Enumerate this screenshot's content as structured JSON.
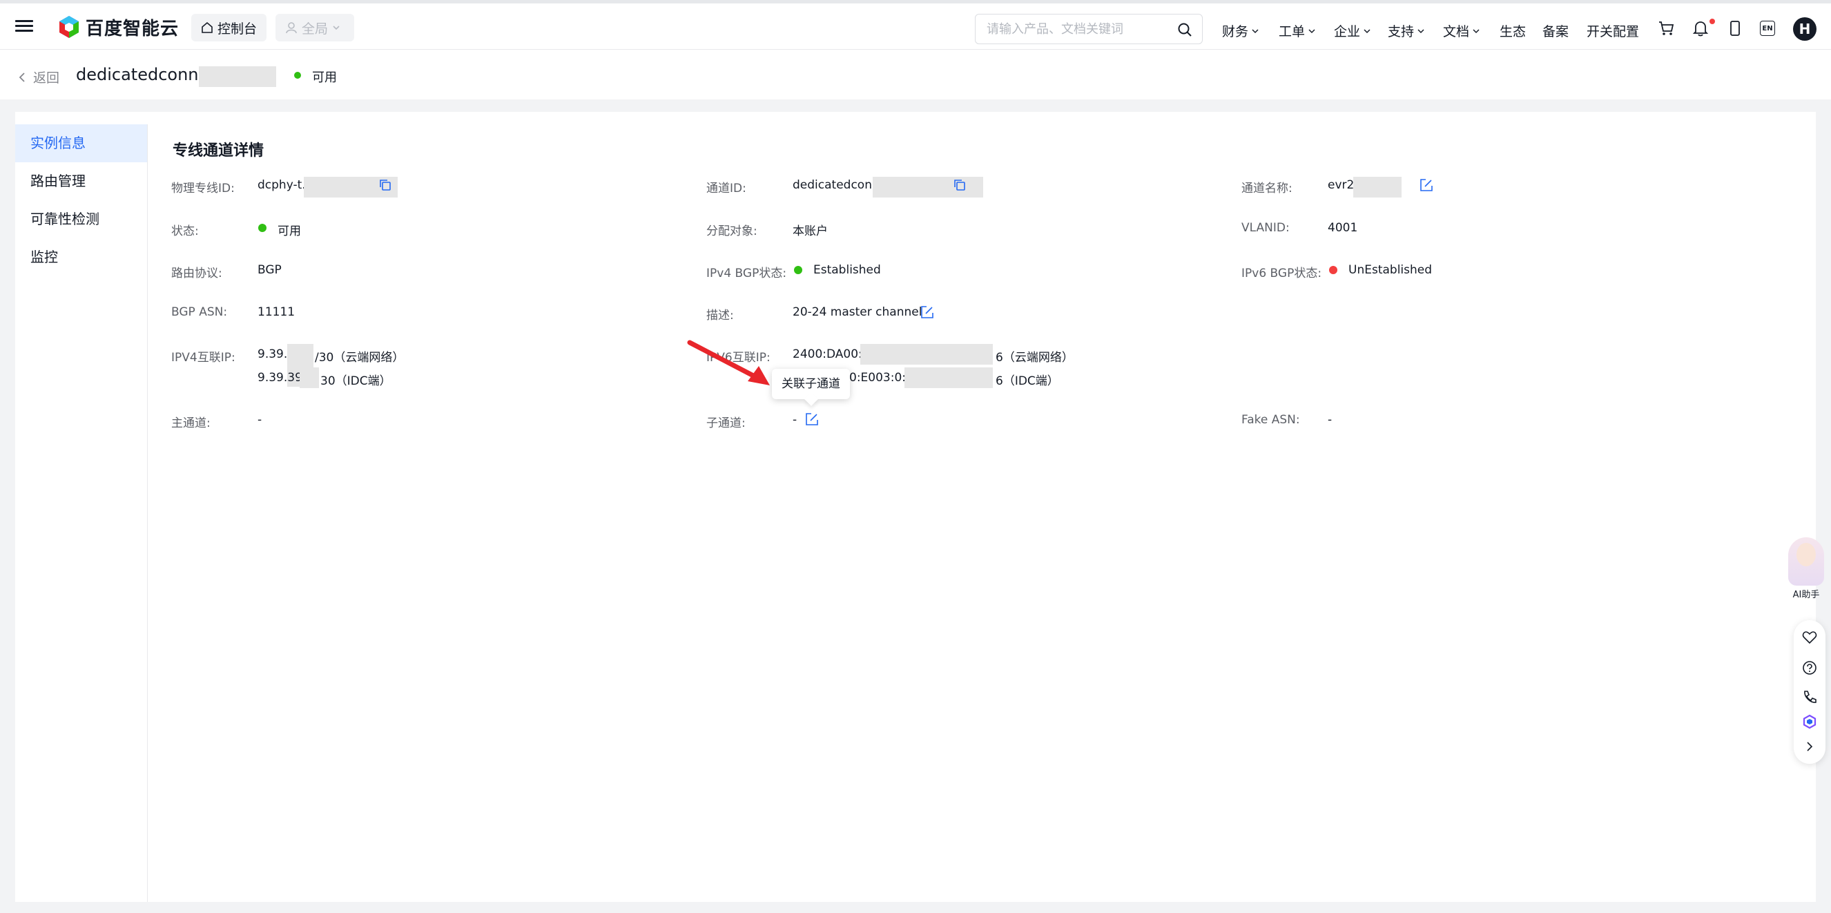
{
  "topbar": {
    "logo_text": "百度智能云",
    "console_label": "控制台",
    "region_label": "全局",
    "search_placeholder": "请输入产品、文档关键词",
    "nav": [
      {
        "label": "财务",
        "dropdown": true
      },
      {
        "label": "工单",
        "dropdown": true
      },
      {
        "label": "企业",
        "dropdown": true
      },
      {
        "label": "支持",
        "dropdown": true
      },
      {
        "label": "文档",
        "dropdown": true
      },
      {
        "label": "生态",
        "dropdown": false
      },
      {
        "label": "备案",
        "dropdown": false
      },
      {
        "label": "开关配置",
        "dropdown": false
      }
    ],
    "icons": [
      "cart-icon",
      "bell-icon",
      "mobile-icon",
      "language-en-icon"
    ],
    "lang_badge": "EN",
    "avatar_letter": "H"
  },
  "header": {
    "back_label": "返回",
    "title": "dedicatedconn",
    "title_suffix": "",
    "status": "可用"
  },
  "sidebar": {
    "items": [
      {
        "label": "实例信息",
        "active": true
      },
      {
        "label": "路由管理",
        "active": false
      },
      {
        "label": "可靠性检测",
        "active": false
      },
      {
        "label": "监控",
        "active": false
      }
    ]
  },
  "details": {
    "title": "专线通道详情",
    "fields": {
      "physical_id": {
        "label": "物理专线ID:",
        "value": "dcphy-t..."
      },
      "channel_id": {
        "label": "通道ID:",
        "value": "dedicatedcon..."
      },
      "channel_name": {
        "label": "通道名称:",
        "value": "evr2..."
      },
      "status": {
        "label": "状态:",
        "value": "可用"
      },
      "assigned_to": {
        "label": "分配对象:",
        "value": "本账户"
      },
      "vlan_id": {
        "label": "VLANID:",
        "value": "4001"
      },
      "route_protocol": {
        "label": "路由协议:",
        "value": "BGP"
      },
      "ipv4_bgp_status": {
        "label": "IPv4 BGP状态:",
        "value": "Established"
      },
      "ipv6_bgp_status": {
        "label": "IPv6 BGP状态:",
        "value": "UnEstablished"
      },
      "bgp_asn": {
        "label": "BGP ASN:",
        "value": "11111"
      },
      "description": {
        "label": "描述:",
        "value": "20-24 master channel"
      },
      "ipv4_interconnect": {
        "label": "IPV4互联IP:",
        "line1": "9.39.",
        "line1_suffix": "/30（云端网络）",
        "line2": "9.39.39",
        "line2_suffix": "30（IDC端）"
      },
      "ipv6_interconnect": {
        "label": "IPV6互联IP:",
        "line1": "2400:DA00:E003:",
        "line1_suffix": "6（云端网络）",
        "line2": "0:E003:0:1",
        "line2_suffix": "6（IDC端）"
      },
      "main_channel": {
        "label": "主通道:",
        "value": "-"
      },
      "sub_channel": {
        "label": "子通道:",
        "value": "-"
      },
      "fake_asn": {
        "label": "Fake ASN:",
        "value": "-"
      }
    },
    "tooltip": "关联子通道"
  },
  "floating": {
    "ai_label": "AI助手",
    "tools": [
      "favorite-icon",
      "help-icon",
      "phone-icon",
      "ai-cube-icon",
      "collapse-chevron-icon"
    ]
  },
  "colors": {
    "primary": "#2468f2",
    "success": "#30bf13",
    "error": "#f33e3e",
    "annotation_arrow": "#e8262b"
  }
}
